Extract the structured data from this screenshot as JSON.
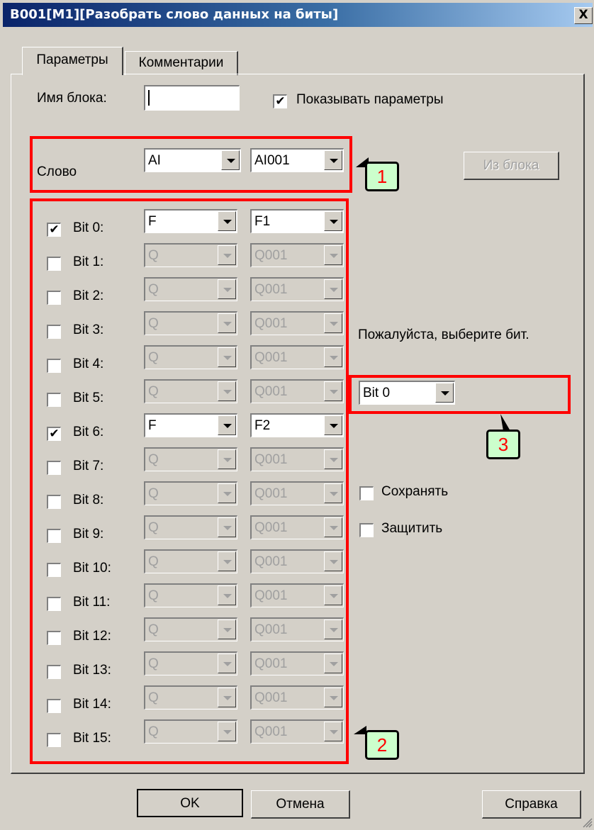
{
  "window": {
    "title": "B001[M1][Разобрать слово данных на биты]",
    "close_label": "X"
  },
  "tabs": [
    {
      "label": "Параметры"
    },
    {
      "label": "Комментарии"
    }
  ],
  "block_name": {
    "label": "Имя блока:",
    "value": ""
  },
  "show_params": {
    "label": "Показывать параметры",
    "checked": true,
    "mark": "✔"
  },
  "word": {
    "label": "Слово",
    "type": "AI",
    "address": "AI001"
  },
  "from_block_label": "Из блока",
  "bits": [
    {
      "label": "Bit 0:",
      "checked": true,
      "mark": "✔",
      "type": "F",
      "address": "F1"
    },
    {
      "label": "Bit 1:",
      "checked": false,
      "mark": "",
      "type": "Q",
      "address": "Q001"
    },
    {
      "label": "Bit 2:",
      "checked": false,
      "mark": "",
      "type": "Q",
      "address": "Q001"
    },
    {
      "label": "Bit 3:",
      "checked": false,
      "mark": "",
      "type": "Q",
      "address": "Q001"
    },
    {
      "label": "Bit 4:",
      "checked": false,
      "mark": "",
      "type": "Q",
      "address": "Q001"
    },
    {
      "label": "Bit 5:",
      "checked": false,
      "mark": "",
      "type": "Q",
      "address": "Q001"
    },
    {
      "label": "Bit 6:",
      "checked": true,
      "mark": "✔",
      "type": "F",
      "address": "F2"
    },
    {
      "label": "Bit 7:",
      "checked": false,
      "mark": "",
      "type": "Q",
      "address": "Q001"
    },
    {
      "label": "Bit 8:",
      "checked": false,
      "mark": "",
      "type": "Q",
      "address": "Q001"
    },
    {
      "label": "Bit 9:",
      "checked": false,
      "mark": "",
      "type": "Q",
      "address": "Q001"
    },
    {
      "label": "Bit 10:",
      "checked": false,
      "mark": "",
      "type": "Q",
      "address": "Q001"
    },
    {
      "label": "Bit 11:",
      "checked": false,
      "mark": "",
      "type": "Q",
      "address": "Q001"
    },
    {
      "label": "Bit 12:",
      "checked": false,
      "mark": "",
      "type": "Q",
      "address": "Q001"
    },
    {
      "label": "Bit 13:",
      "checked": false,
      "mark": "",
      "type": "Q",
      "address": "Q001"
    },
    {
      "label": "Bit 14:",
      "checked": false,
      "mark": "",
      "type": "Q",
      "address": "Q001"
    },
    {
      "label": "Bit 15:",
      "checked": false,
      "mark": "",
      "type": "Q",
      "address": "Q001"
    }
  ],
  "select_bit": {
    "prompt": "Пожалуйста, выберите бит.",
    "value": "Bit 0"
  },
  "retain": {
    "label": "Сохранять",
    "checked": false,
    "mark": ""
  },
  "protect": {
    "label": "Защитить",
    "checked": false,
    "mark": ""
  },
  "buttons": {
    "ok": "OK",
    "cancel": "Отмена",
    "help": "Справка"
  },
  "callouts": [
    "1",
    "2",
    "3"
  ],
  "colors": {
    "title_start": "#0a246a",
    "title_end": "#a6caf0",
    "dialog_bg": "#d4d0c8",
    "highlight": "#ff0000",
    "callout_bg": "#ccffcc",
    "disabled_text": "#a0a0a0"
  }
}
